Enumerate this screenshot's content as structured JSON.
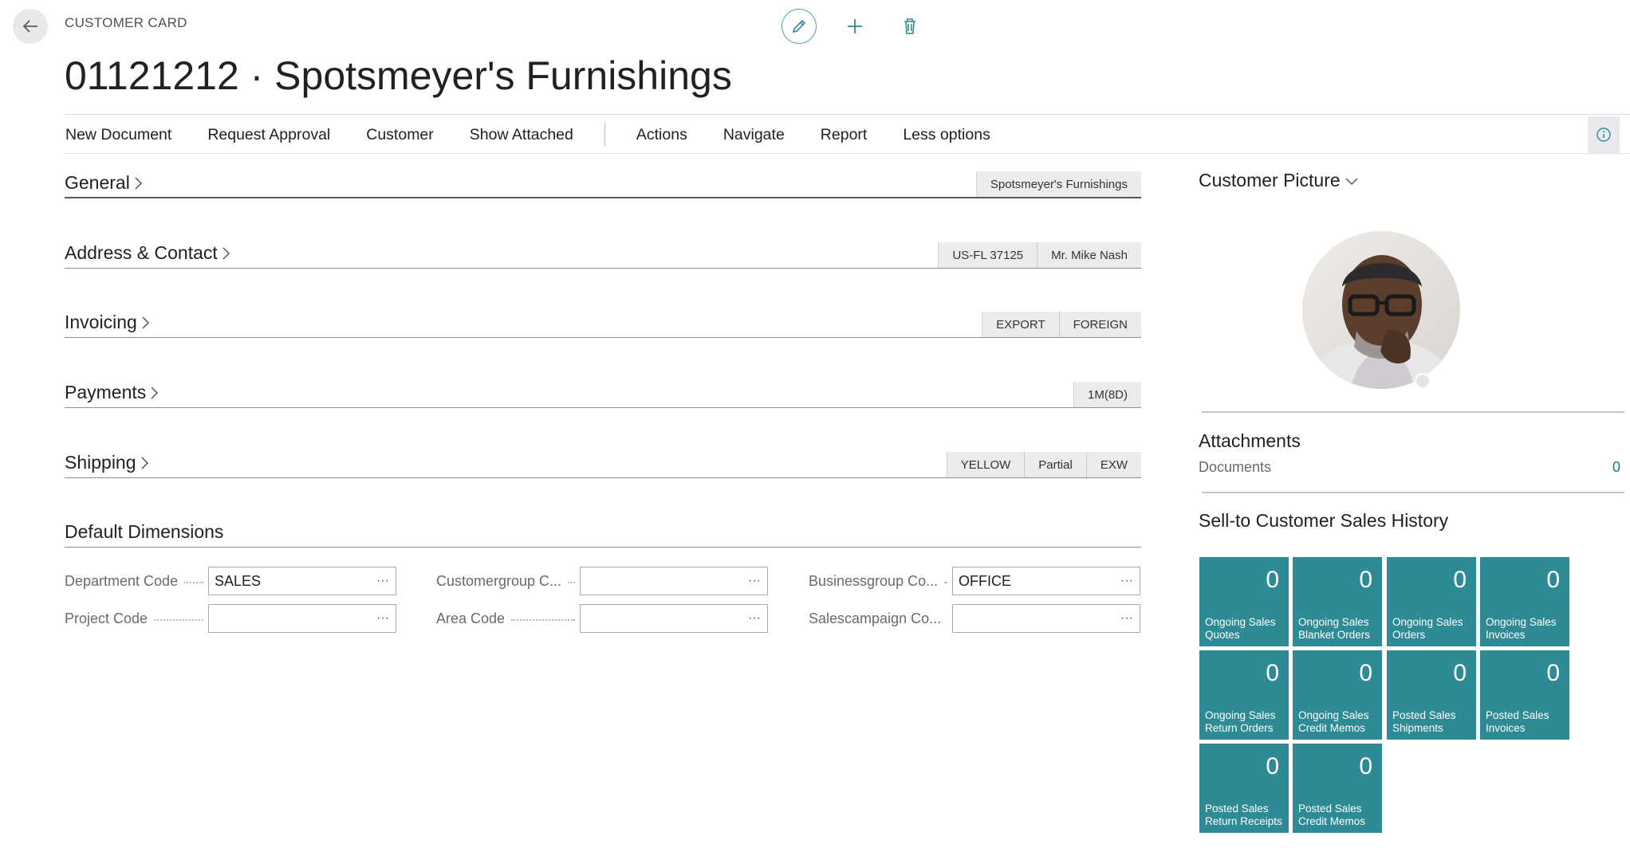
{
  "header": {
    "caption": "CUSTOMER CARD",
    "title": "01121212 · Spotsmeyer's Furnishings"
  },
  "actionbar": {
    "items": [
      "New Document",
      "Request Approval",
      "Customer",
      "Show Attached"
    ],
    "items2": [
      "Actions",
      "Navigate",
      "Report",
      "Less options"
    ]
  },
  "fasttabs": {
    "general": {
      "title": "General",
      "chips": [
        "Spotsmeyer's Furnishings"
      ]
    },
    "address": {
      "title": "Address & Contact",
      "chips": [
        "US-FL 37125",
        "Mr. Mike Nash"
      ]
    },
    "invoicing": {
      "title": "Invoicing",
      "chips": [
        "EXPORT",
        "FOREIGN"
      ]
    },
    "payments": {
      "title": "Payments",
      "chips": [
        "1M(8D)"
      ]
    },
    "shipping": {
      "title": "Shipping",
      "chips": [
        "YELLOW",
        "Partial",
        "EXW"
      ]
    }
  },
  "dimensions": {
    "title": "Default Dimensions",
    "fields": [
      {
        "label": "Department Code",
        "value": "SALES"
      },
      {
        "label": "Customergroup C...",
        "value": ""
      },
      {
        "label": "Businessgroup Co...",
        "value": "OFFICE"
      },
      {
        "label": "Project Code",
        "value": ""
      },
      {
        "label": "Area Code",
        "value": ""
      },
      {
        "label": "Salescampaign Co...",
        "value": ""
      }
    ],
    "ellipsis": "···"
  },
  "factbox": {
    "picture_title": "Customer Picture",
    "attachments_title": "Attachments",
    "documents_label": "Documents",
    "documents_count": "0",
    "history_title": "Sell-to Customer Sales History",
    "tiles": [
      {
        "value": "0",
        "label": "Ongoing Sales Quotes"
      },
      {
        "value": "0",
        "label": "Ongoing Sales Blanket Orders"
      },
      {
        "value": "0",
        "label": "Ongoing Sales Orders"
      },
      {
        "value": "0",
        "label": "Ongoing Sales Invoices"
      },
      {
        "value": "0",
        "label": "Ongoing Sales Return Orders"
      },
      {
        "value": "0",
        "label": "Ongoing Sales Credit Memos"
      },
      {
        "value": "0",
        "label": "Posted Sales Shipments"
      },
      {
        "value": "0",
        "label": "Posted Sales Invoices"
      },
      {
        "value": "0",
        "label": "Posted Sales Return Receipts"
      },
      {
        "value": "0",
        "label": "Posted Sales Credit Memos"
      }
    ]
  },
  "colors": {
    "accent": "#2e8a94",
    "link": "#1f7a85",
    "text": "#212121",
    "muted": "#6a6a6a"
  }
}
